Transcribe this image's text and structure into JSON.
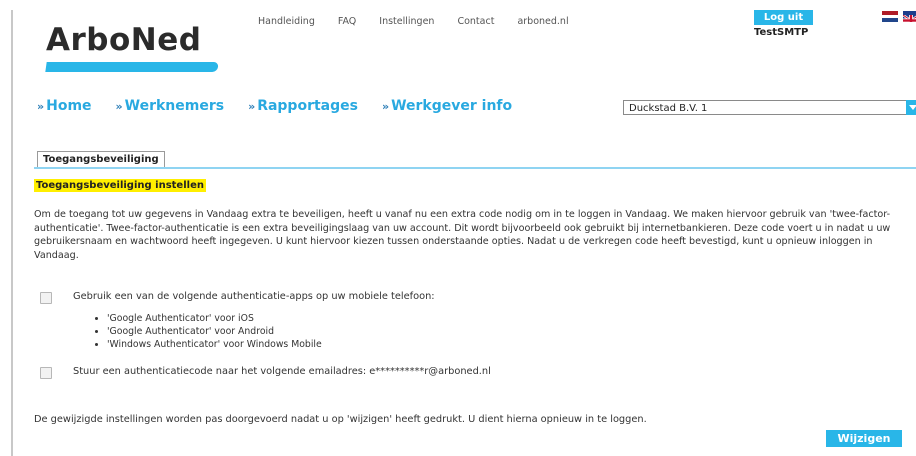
{
  "brand": {
    "logo_text": "ArboNed",
    "accent": "#29b6e8"
  },
  "toplinks": [
    "Handleiding",
    "FAQ",
    "Instellingen",
    "Contact",
    "arboned.nl"
  ],
  "account": {
    "logout_label": "Log uit",
    "username": "TestSMTP"
  },
  "nav": {
    "arrow": "»",
    "items": [
      "Home",
      "Werknemers",
      "Rapportages",
      "Werkgever info"
    ]
  },
  "company_select": {
    "value": "Duckstad B.V. 1"
  },
  "tab": {
    "label": "Toegangsbeveiliging"
  },
  "section": {
    "heading": "Toegangsbeveiliging instellen",
    "intro": "Om de toegang tot uw gegevens in Vandaag extra te beveiligen, heeft u vanaf nu een extra code nodig om in te loggen in Vandaag. We maken hiervoor gebruik van 'twee-factor-authenticatie'. Twee-factor-authenticatie is een extra beveiligingslaag van uw account. Dit wordt bijvoorbeeld ook gebruikt bij internetbankieren. Deze code voert u in nadat u uw gebruikersnaam en wachtwoord heeft ingegeven. U kunt hiervoor kiezen tussen onderstaande opties. Nadat u de verkregen code heeft bevestigd, kunt u opnieuw inloggen in Vandaag."
  },
  "options": {
    "app_label": "Gebruik een van de volgende authenticatie-apps op uw mobiele telefoon:",
    "apps": [
      "'Google Authenticator' voor iOS",
      "'Google Authenticator' voor Android",
      "'Windows Authenticator' voor Windows Mobile"
    ],
    "email_label": "Stuur een authenticatiecode naar het volgende emailadres: e**********r@arboned.nl"
  },
  "footer": {
    "note": "De gewijzigde instellingen worden pas doorgevoerd nadat u op 'wijzigen' heeft gedrukt. U dient hierna opnieuw in te loggen.",
    "save_label": "Wijzigen"
  }
}
